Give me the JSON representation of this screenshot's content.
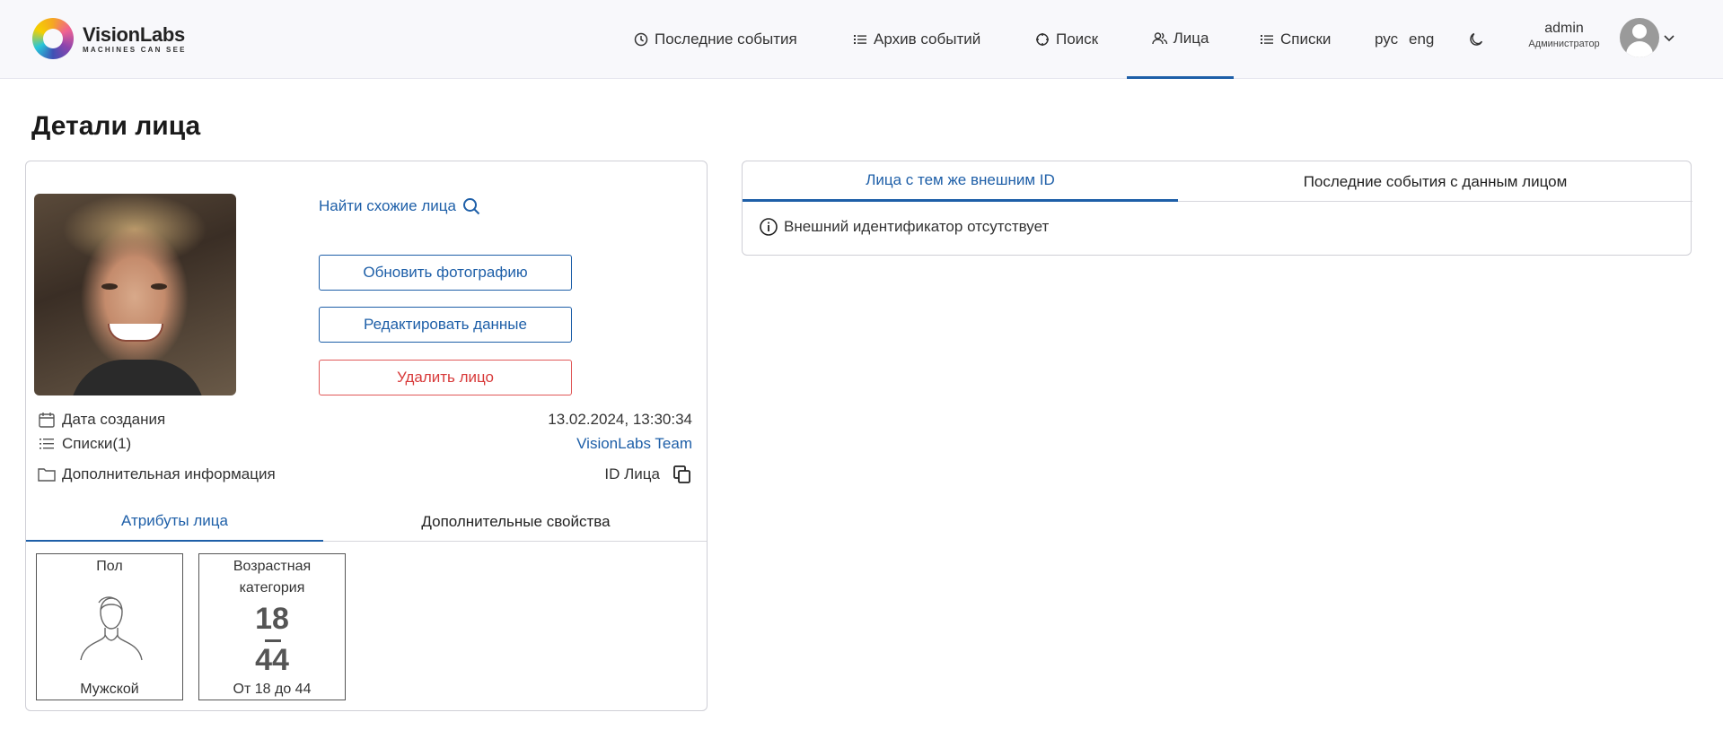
{
  "brand": {
    "name": "VisionLabs",
    "tagline": "MACHINES CAN SEE"
  },
  "nav": {
    "items": [
      {
        "label": "Последние события",
        "icon": "clock-icon"
      },
      {
        "label": "Архив событий",
        "icon": "list-icon"
      },
      {
        "label": "Поиск",
        "icon": "target-icon"
      },
      {
        "label": "Лица",
        "icon": "users-icon",
        "active": true
      },
      {
        "label": "Списки",
        "icon": "list-icon"
      }
    ],
    "lang_ru": "рус",
    "lang_en": "eng",
    "theme_icon": "moon-icon"
  },
  "user": {
    "name": "admin",
    "role": "Администратор"
  },
  "page": {
    "title": "Детали лица"
  },
  "face": {
    "find_similar": "Найти схожие лица",
    "buttons": {
      "update_photo": "Обновить фотографию",
      "edit_data": "Редактировать данные",
      "delete_face": "Удалить лицо"
    },
    "created_label": "Дата создания",
    "created_value": "13.02.2024, 13:30:34",
    "lists_label": "Списки(1)",
    "lists_value": "VisionLabs Team",
    "extra_label": "Дополнительная информация",
    "face_id_label": "ID Лица"
  },
  "subtabs": {
    "attributes": "Атрибуты лица",
    "extra_props": "Дополнительные свойства"
  },
  "attributes": {
    "gender": {
      "label": "Пол",
      "value": "Мужской"
    },
    "age": {
      "label_line1": "Возрастная",
      "label_line2": "категория",
      "from": "18",
      "to": "44",
      "value": "От 18 до 44"
    }
  },
  "right_panel": {
    "tabs": {
      "same_external_id": "Лица с тем же внешним ID",
      "recent_events": "Последние события с данным лицом"
    },
    "note": "Внешний идентификатор отсутствует"
  },
  "colors": {
    "accent": "#1e5fa8",
    "danger": "#d83a3a"
  }
}
